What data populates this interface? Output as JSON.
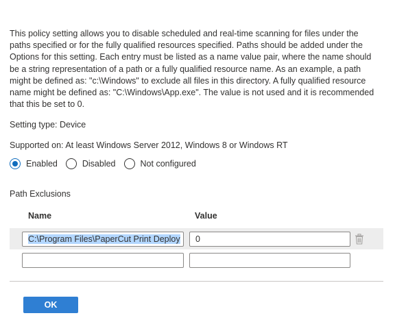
{
  "policy": {
    "description": "This policy setting allows you to disable scheduled and real-time scanning for files under the paths specified or for the fully qualified resources specified. Paths should be added under the Options for this setting. Each entry must be listed as a name value pair, where the name should be a string representation of a path or a fully qualified resource name. As an example, a path might be defined as: \"c:\\Windows\" to exclude all files in this directory. A fully qualified resource name might be defined as: \"C:\\Windows\\App.exe\". The value is not used and it is recommended that this be set to 0.",
    "setting_type": "Setting type: Device",
    "supported_on": "Supported on: At least Windows Server 2012, Windows 8 or Windows RT"
  },
  "state": {
    "options": [
      {
        "label": "Enabled",
        "selected": true
      },
      {
        "label": "Disabled",
        "selected": false
      },
      {
        "label": "Not configured",
        "selected": false
      }
    ]
  },
  "exclusions": {
    "title": "Path Exclusions",
    "name_header": "Name",
    "value_header": "Value",
    "rows": [
      {
        "name": "C:\\Program Files\\PaperCut Print Deploy",
        "value": "0"
      },
      {
        "name": "",
        "value": ""
      }
    ]
  },
  "footer": {
    "ok_label": "OK"
  },
  "colors": {
    "accent": "#0f6cbd",
    "ok_button": "#2f7fd3",
    "selection": "#b3d7ff"
  },
  "icons": {
    "delete": "trash-icon"
  }
}
